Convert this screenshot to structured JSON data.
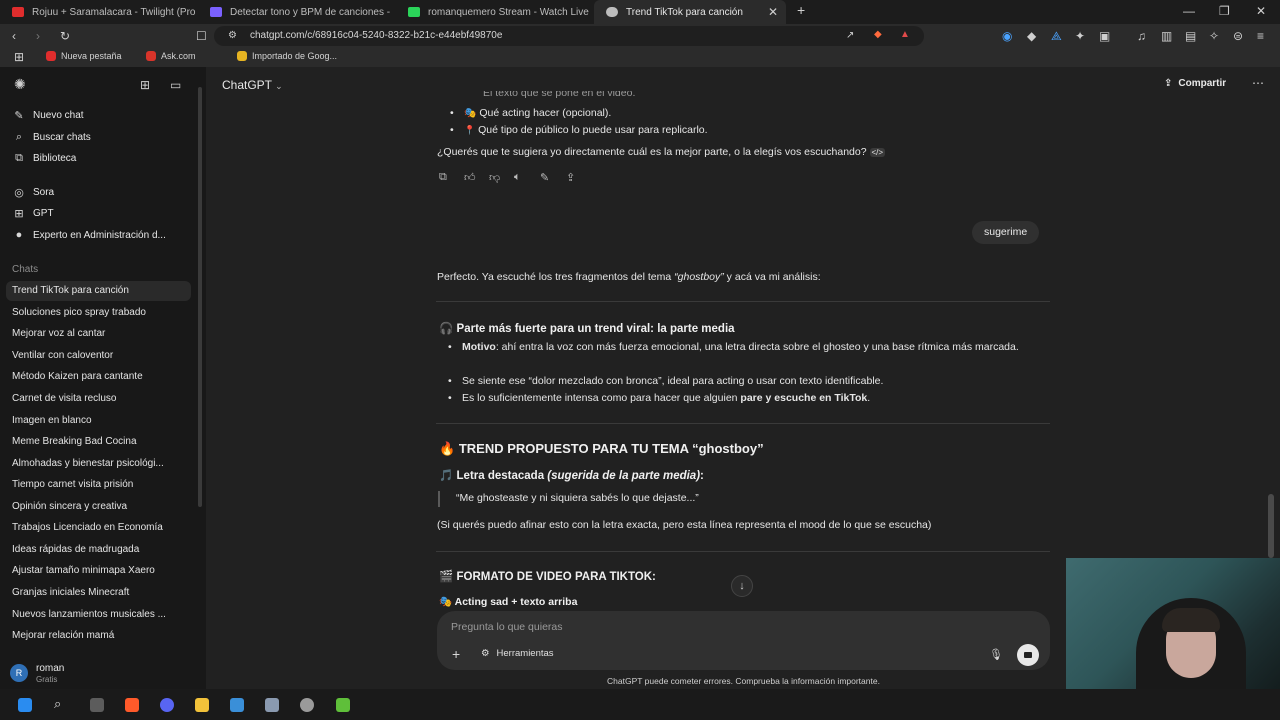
{
  "browser": {
    "tabs": [
      {
        "title": "Rojuu + Saramalacara - Twilight (Pro",
        "favicon_color": "#e02d2d"
      },
      {
        "title": "Detectar tono y BPM de canciones -",
        "favicon_color": "#7b61ff"
      },
      {
        "title": "romanquemero Stream - Watch Live",
        "favicon_color": "#2bd45a"
      },
      {
        "title": "Trend TikTok para canción",
        "favicon_color": "#bdbdbd",
        "active": true
      }
    ],
    "new_tab_glyph": "+",
    "url": "chatgpt.com/c/68916c04-5240-8322-b21c-e44ebf49870e",
    "bookmarks": [
      {
        "label": "Nueva pestaña",
        "color": "#e02d2d"
      },
      {
        "label": "Ask.com",
        "color": "#d8342a"
      },
      {
        "label": "Importado de Goog...",
        "color": "#e6b422"
      }
    ]
  },
  "sidebar": {
    "top_items": [
      {
        "label": "Nuevo chat",
        "icon": "edit-icon"
      },
      {
        "label": "Buscar chats",
        "icon": "search-icon"
      },
      {
        "label": "Biblioteca",
        "icon": "library-icon"
      }
    ],
    "gpt_items": [
      {
        "label": "Sora",
        "icon": "sora-icon"
      },
      {
        "label": "GPT",
        "icon": "grid-icon"
      },
      {
        "label": "Experto en Administración d...",
        "icon": "avatar-icon"
      }
    ],
    "chats_label": "Chats",
    "chats": [
      "Trend TikTok para canción",
      "Soluciones pico spray trabado",
      "Mejorar voz al cantar",
      "Ventilar con caloventor",
      "Método Kaizen para cantante",
      "Carnet de visita recluso",
      "Imagen en blanco",
      "Meme Breaking Bad Cocina",
      "Almohadas y bienestar psicológi...",
      "Tiempo carnet visita prisión",
      "Opinión sincera y creativa",
      "Trabajos Licenciado en Economía",
      "Ideas rápidas de madrugada",
      "Ajustar tamaño minimapa Xaero",
      "Granjas iniciales Minecraft",
      "Nuevos lanzamientos musicales ...",
      "Mejorar relación mamá"
    ],
    "user": {
      "initial": "R",
      "name": "roman",
      "plan": "Gratis"
    }
  },
  "header": {
    "model": "ChatGPT",
    "share": "Compartir"
  },
  "conversation": {
    "prev_cut": "El texto que se pone en el video.",
    "prev_bullets": [
      "Qué acting hacer (opcional).",
      "Qué tipo de público lo puede usar para replicarlo."
    ],
    "prev_question": "¿Querés que te sugiera yo directamente cuál es la mejor parte, o la elegís vos escuchando?",
    "user_msg": "sugerime",
    "intro_pre": "Perfecto. Ya escuché los tres fragmentos del tema ",
    "intro_em": "“ghostboy”",
    "intro_post": " y acá va mi análisis:",
    "section1_title": "Parte más fuerte para un trend viral: la parte media",
    "s1_b1_bold": "Motivo",
    "s1_b1_rest": ": ahí entra la voz con más fuerza emocional, una letra directa sobre el ghosteo y una base rítmica más marcada.",
    "s1_b2": "Se siente ese “dolor mezclado con bronca”, ideal para acting o usar con texto identificable.",
    "s1_b3_pre": "Es lo suficientemente intensa como para hacer que alguien ",
    "s1_b3_bold": "pare y escuche en TikTok",
    "s1_b3_post": ".",
    "section2_title": "TREND PROPUESTO PARA TU TEMA “ghostboy”",
    "letra_title": "Letra destacada ",
    "letra_em": "(sugerida de la parte media)",
    "letra_colon": ":",
    "quote": "“Me ghosteaste y ni siquiera sabés lo que dejaste...”",
    "note": "(Si querés puedo afinar esto con la letra exacta, pero esta línea representa el mood de lo que se escucha)",
    "section3_title": "FORMATO DE VIDEO PARA TIKTOK:",
    "format_sub": "Acting sad + texto arriba"
  },
  "composer": {
    "placeholder": "Pregunta lo que quieras",
    "tools": "Herramientas",
    "disclaimer": "ChatGPT puede cometer errores. Comprueba la información importante."
  }
}
